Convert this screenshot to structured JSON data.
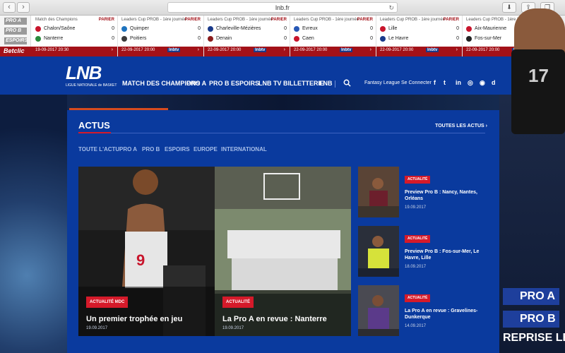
{
  "browser": {
    "url": "lnb.fr",
    "back": "‹",
    "forward": "›",
    "reload": "↻"
  },
  "ticker": {
    "logos": [
      "PRO A",
      "PRO B",
      "ESPOIRS"
    ],
    "sponsor": "Betclic",
    "parier": "PARIER",
    "next": "›",
    "matches": [
      {
        "comp": "Match des Champions",
        "home": "Chalon/Saône",
        "away": "Nanterre",
        "home_score": "0",
        "away_score": "0",
        "date": "19-09-2017 20:30",
        "home_color": "#c8152c",
        "away_color": "#2a8a3c",
        "tv": ""
      },
      {
        "comp": "Leaders Cup PROB - 1ère journée",
        "home": "Quimper",
        "away": "Poitiers",
        "home_score": "0",
        "away_score": "0",
        "date": "22-09-2017 20:00",
        "home_color": "#1e73be",
        "away_color": "#3b3b3b",
        "tv": "lnbtv"
      },
      {
        "comp": "Leaders Cup PROB - 1ère journée",
        "home": "Charleville-Mézières",
        "away": "Denain",
        "home_score": "0",
        "away_score": "0",
        "date": "22-09-2017 20:00",
        "home_color": "#1a3a8a",
        "away_color": "#8a1c1c",
        "tv": "lnbtv"
      },
      {
        "comp": "Leaders Cup PROB - 1ère journée",
        "home": "Evreux",
        "away": "Caen",
        "home_score": "0",
        "away_score": "0",
        "date": "22-09-2017 20:00",
        "home_color": "#2758b5",
        "away_color": "#c8152c",
        "tv": "lnbtv"
      },
      {
        "comp": "Leaders Cup PROB - 1ère journée",
        "home": "Lille",
        "away": "Le Havre",
        "home_score": "0",
        "away_score": "0",
        "date": "22-09-2017 20:00",
        "home_color": "#c8152c",
        "away_color": "#1a3a8a",
        "tv": "lnbtv"
      },
      {
        "comp": "Leaders Cup PROB - 1ère journée",
        "home": "Aix-Maurienne",
        "away": "Fos-sur-Mer",
        "home_score": "0",
        "away_score": "0",
        "date": "22-09-2017 20:00",
        "home_color": "#c8152c",
        "away_color": "#222222",
        "tv": "lnbtv"
      }
    ]
  },
  "header": {
    "logo": "LNB",
    "logo_sub": "LIGUE NATIONALE de BASKET",
    "nav": [
      "MATCH DES CHAMPIONS",
      "PRO A",
      "PRO B",
      "ESPOIRS",
      "LNB TV",
      "BILLETTERIE",
      "LNB"
    ],
    "fantasy": "Fantasy League",
    "connect": "Se Connecter",
    "social": [
      "f",
      "t",
      "in",
      "◎",
      "◉",
      "d"
    ]
  },
  "actus": {
    "title": "ACTUS",
    "all_link": "TOUTES LES ACTUS",
    "filters": [
      "TOUTE L'ACTU",
      "PRO A",
      "PRO B",
      "ESPOIRS",
      "EUROPE",
      "INTERNATIONAL"
    ],
    "featured": [
      {
        "badge": "ACTUALITÉ MDC",
        "title": "Un premier trophée en jeu",
        "date": "19.09.2017"
      },
      {
        "badge": "ACTUALITÉ",
        "title": "La Pro A en revue : Nanterre",
        "date": "19.09.2017"
      }
    ],
    "side": [
      {
        "badge": "ACTUALITÉ",
        "title": "Preview Pro B : Nancy, Nantes, Orléans",
        "date": "19.09.2017"
      },
      {
        "badge": "ACTUALITÉ",
        "title": "Preview Pro B : Fos-sur-Mer, Le Havre, Lille",
        "date": "18.09.2017"
      },
      {
        "badge": "ACTUALITÉ",
        "title": "La Pro A en revue : Gravelines-Dunkerque",
        "date": "14.09.2017"
      }
    ]
  },
  "promo": {
    "badges": [
      "PRO A",
      "PRO B"
    ],
    "banner": "REPRISE LE",
    "jersey_number": "17"
  },
  "colors": {
    "brand_blue": "#0a3a9e",
    "accent_red": "#d51a2a",
    "ticker_red": "#a31118"
  }
}
